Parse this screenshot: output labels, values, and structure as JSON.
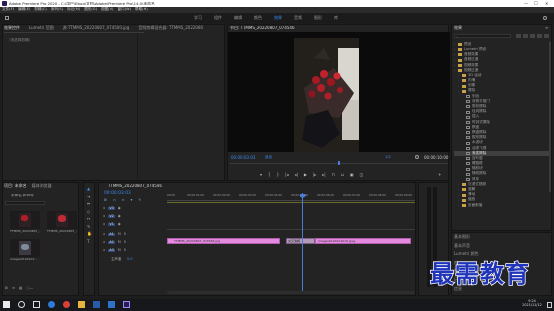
{
  "titlebar": {
    "title": "Adobe Premiere Pro 2020 - C:\\用户\\Ebug\\文档\\Adobe\\Premiere Pro\\14.0\\未命名",
    "minimize": "—",
    "maximize": "□",
    "close": "✕"
  },
  "menu": [
    "文件(F)",
    "编辑(E)",
    "剪辑(C)",
    "序列(S)",
    "标记(M)",
    "图形(G)",
    "视图(V)",
    "窗口(W)",
    "帮助(H)"
  ],
  "workspaces": [
    "学习",
    "组件",
    "编辑",
    "颜色",
    "效果",
    "音频",
    "图形",
    "库"
  ],
  "workspace_active": "效果",
  "source_panel": {
    "tabs": [
      "效果控件",
      "Lumetri 范围",
      "源:TTMMS_20220807_074500.jpg",
      "音频剪辑混合器: TTMMS_2022080"
    ],
    "empty_label": "（未选择剪辑）"
  },
  "program_monitor": {
    "tab": "节目: TTMMS_20220807_074546",
    "timecode": "00:00:03:03",
    "fit": "适合",
    "quality": "1/2",
    "duration": "00:00:10:00"
  },
  "project_panel": {
    "tabs": [
      "项目: 未命名",
      "媒体浏览器"
    ],
    "project_file": "未命名.prproj",
    "search_placeholder": "",
    "items": [
      {
        "label": "TTMMS_20220807_...",
        "duration": "5:00"
      },
      {
        "label": "TTMMS_20220807_...",
        "duration": "5:00"
      },
      {
        "label": "images0100101...",
        "duration": "5:00"
      }
    ]
  },
  "timeline": {
    "tab": "TTMMS_20220807_074546",
    "timecode": "00:00:03:03",
    "ruler": [
      "00:00",
      "00:00:01:00",
      "00:00:02:00",
      "00:00:03:00",
      "00:00:04:00",
      "00:00:05:00",
      "00:00:06:00",
      "00:00:07:00",
      "00:00:08:00",
      "00:00:09:00"
    ],
    "tracks": [
      "V3",
      "V2",
      "V1",
      "A1",
      "A2",
      "A3"
    ],
    "master": "主声道",
    "master_value": "0.0",
    "clips": [
      {
        "label": "TTMMS_20220807_074546.jpg"
      },
      {
        "label": "交叉溶解"
      },
      {
        "label": "images0100101010.jpeg"
      }
    ],
    "track_colors": {
      "video_clip": "#e48be0",
      "transition": "#b39ab8",
      "playhead": "#4a7bd6"
    }
  },
  "effects": {
    "tab": "效果",
    "search_placeholder": "",
    "tree": [
      {
        "label": "预设",
        "level": 0,
        "kind": "folder"
      },
      {
        "label": "Lumetri 预设",
        "level": 0,
        "kind": "folder"
      },
      {
        "label": "音频效果",
        "level": 0,
        "kind": "folder"
      },
      {
        "label": "音频过渡",
        "level": 0,
        "kind": "folder"
      },
      {
        "label": "视频效果",
        "level": 0,
        "kind": "folder"
      },
      {
        "label": "视频过渡",
        "level": 0,
        "kind": "folder"
      },
      {
        "label": "3D 运动",
        "level": 1,
        "kind": "folder"
      },
      {
        "label": "内滑",
        "level": 1,
        "kind": "folder"
      },
      {
        "label": "划像",
        "level": 1,
        "kind": "folder"
      },
      {
        "label": "擦除",
        "level": 1,
        "kind": "folder"
      },
      {
        "label": "划出",
        "level": 2,
        "kind": "fx"
      },
      {
        "label": "双侧平推门",
        "level": 2,
        "kind": "fx"
      },
      {
        "label": "带状擦除",
        "level": 2,
        "kind": "fx"
      },
      {
        "label": "径向擦除",
        "level": 2,
        "kind": "fx"
      },
      {
        "label": "插入",
        "level": 2,
        "kind": "fx"
      },
      {
        "label": "时钟式擦除",
        "level": 2,
        "kind": "fx"
      },
      {
        "label": "棋盘",
        "level": 2,
        "kind": "fx"
      },
      {
        "label": "棋盘擦除",
        "level": 2,
        "kind": "fx"
      },
      {
        "label": "楔形擦除",
        "level": 2,
        "kind": "fx"
      },
      {
        "label": "水波块",
        "level": 2,
        "kind": "fx"
      },
      {
        "label": "油漆飞溅",
        "level": 2,
        "kind": "fx"
      },
      {
        "label": "渐变擦除",
        "level": 2,
        "kind": "fx",
        "selected": true
      },
      {
        "label": "百叶窗",
        "level": 2,
        "kind": "fx"
      },
      {
        "label": "螺旋框",
        "level": 2,
        "kind": "fx"
      },
      {
        "label": "随机块",
        "level": 2,
        "kind": "fx"
      },
      {
        "label": "随机擦除",
        "level": 2,
        "kind": "fx"
      },
      {
        "label": "风车",
        "level": 2,
        "kind": "fx"
      },
      {
        "label": "沉浸式视频",
        "level": 1,
        "kind": "folder"
      },
      {
        "label": "溶解",
        "level": 1,
        "kind": "folder"
      },
      {
        "label": "滑动",
        "level": 1,
        "kind": "folder"
      },
      {
        "label": "缩放",
        "level": 1,
        "kind": "folder"
      },
      {
        "label": "页面剥落",
        "level": 1,
        "kind": "folder"
      }
    ],
    "bottom_panels": [
      "基本图形",
      "基本声音",
      "Lumetri 颜色",
      "库",
      "标记",
      "历史记录",
      "信息"
    ]
  },
  "watermark": "最需教育",
  "taskbar": {
    "time": "9:24",
    "date": "2021/11/12"
  }
}
